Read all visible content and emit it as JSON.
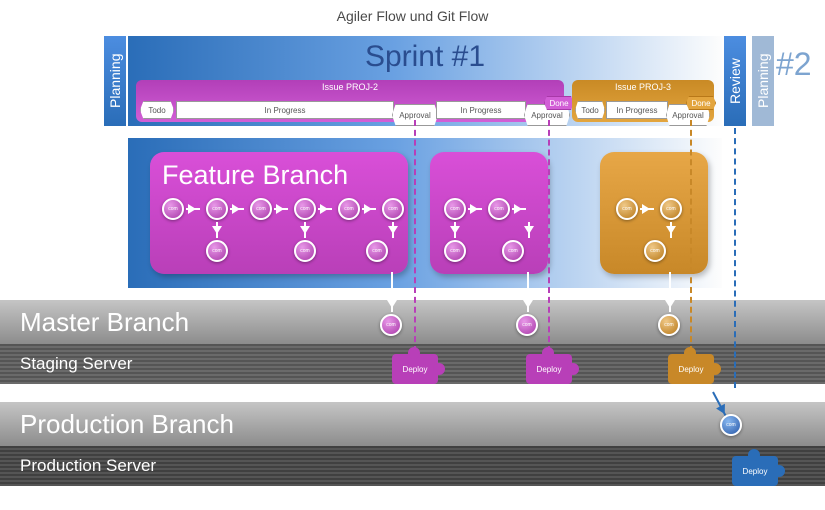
{
  "title": "Agiler Flow und Git Flow",
  "sprint": {
    "label": "Sprint #1",
    "next": "#2"
  },
  "phases": {
    "planning": "Planning",
    "review": "Review"
  },
  "issues": {
    "p": {
      "id": "Issue PROJ-2",
      "lanes": [
        "Todo",
        "In Progress",
        "Approval",
        "In Progress",
        "Approval",
        "Done"
      ]
    },
    "o": {
      "id": "Issue PROJ-3",
      "lanes": [
        "Todo",
        "In Progress",
        "Approval",
        "Done"
      ]
    }
  },
  "feature": {
    "title": "Feature Branch",
    "commit_label": "com"
  },
  "bands": {
    "master": "Master Branch",
    "staging": "Staging Server",
    "production": "Production Branch",
    "prodserver": "Production Server"
  },
  "deploy": "Deploy",
  "colors": {
    "purple": "#b83fb8",
    "orange": "#c88828",
    "blue": "#2a6db8"
  }
}
